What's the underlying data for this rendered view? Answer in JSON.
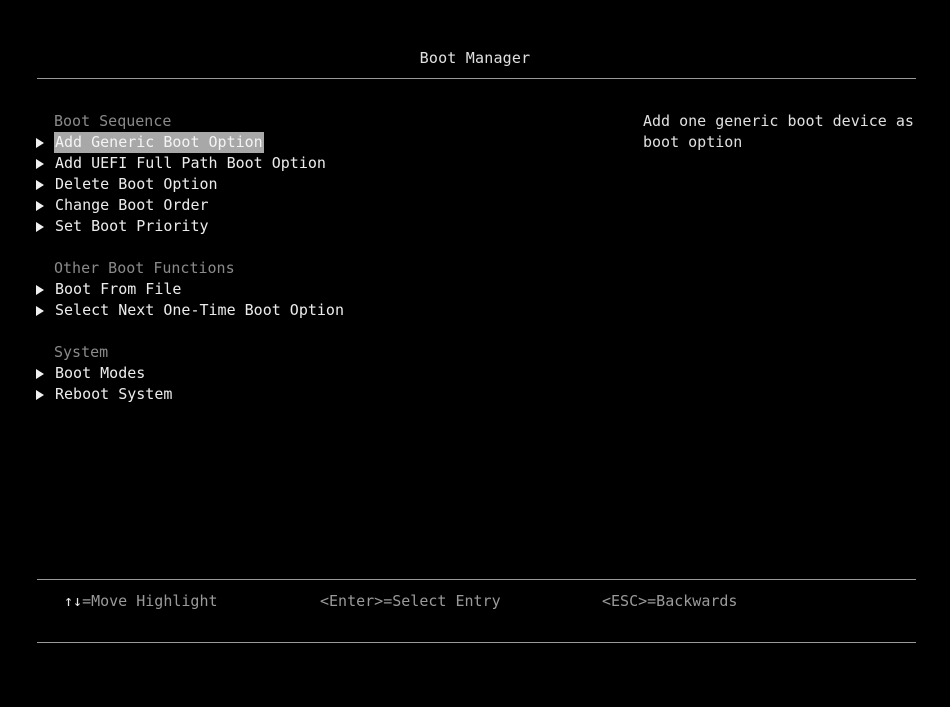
{
  "title": "Boot Manager",
  "sections": [
    {
      "heading": "Boot Sequence",
      "items": [
        {
          "label": "Add Generic Boot Option",
          "selected": true
        },
        {
          "label": "Add UEFI Full Path Boot Option",
          "selected": false
        },
        {
          "label": "Delete Boot Option",
          "selected": false
        },
        {
          "label": "Change Boot Order",
          "selected": false
        },
        {
          "label": "Set Boot Priority",
          "selected": false
        }
      ]
    },
    {
      "heading": "Other Boot Functions",
      "items": [
        {
          "label": "Boot From File",
          "selected": false
        },
        {
          "label": "Select Next One-Time Boot Option",
          "selected": false
        }
      ]
    },
    {
      "heading": "System",
      "items": [
        {
          "label": "Boot Modes",
          "selected": false
        },
        {
          "label": "Reboot System",
          "selected": false
        }
      ]
    }
  ],
  "help_text": "Add one generic boot device as boot option",
  "footer": {
    "move_key": "↑↓",
    "move_text": "=Move Highlight",
    "enter_hint": "<Enter>=Select Entry",
    "esc_hint": "<ESC>=Backwards"
  },
  "colors": {
    "background": "#000000",
    "text": "#ececec",
    "heading": "#8a8a8a",
    "highlight": "#a8a8a8",
    "rule": "#9a9a9a"
  }
}
